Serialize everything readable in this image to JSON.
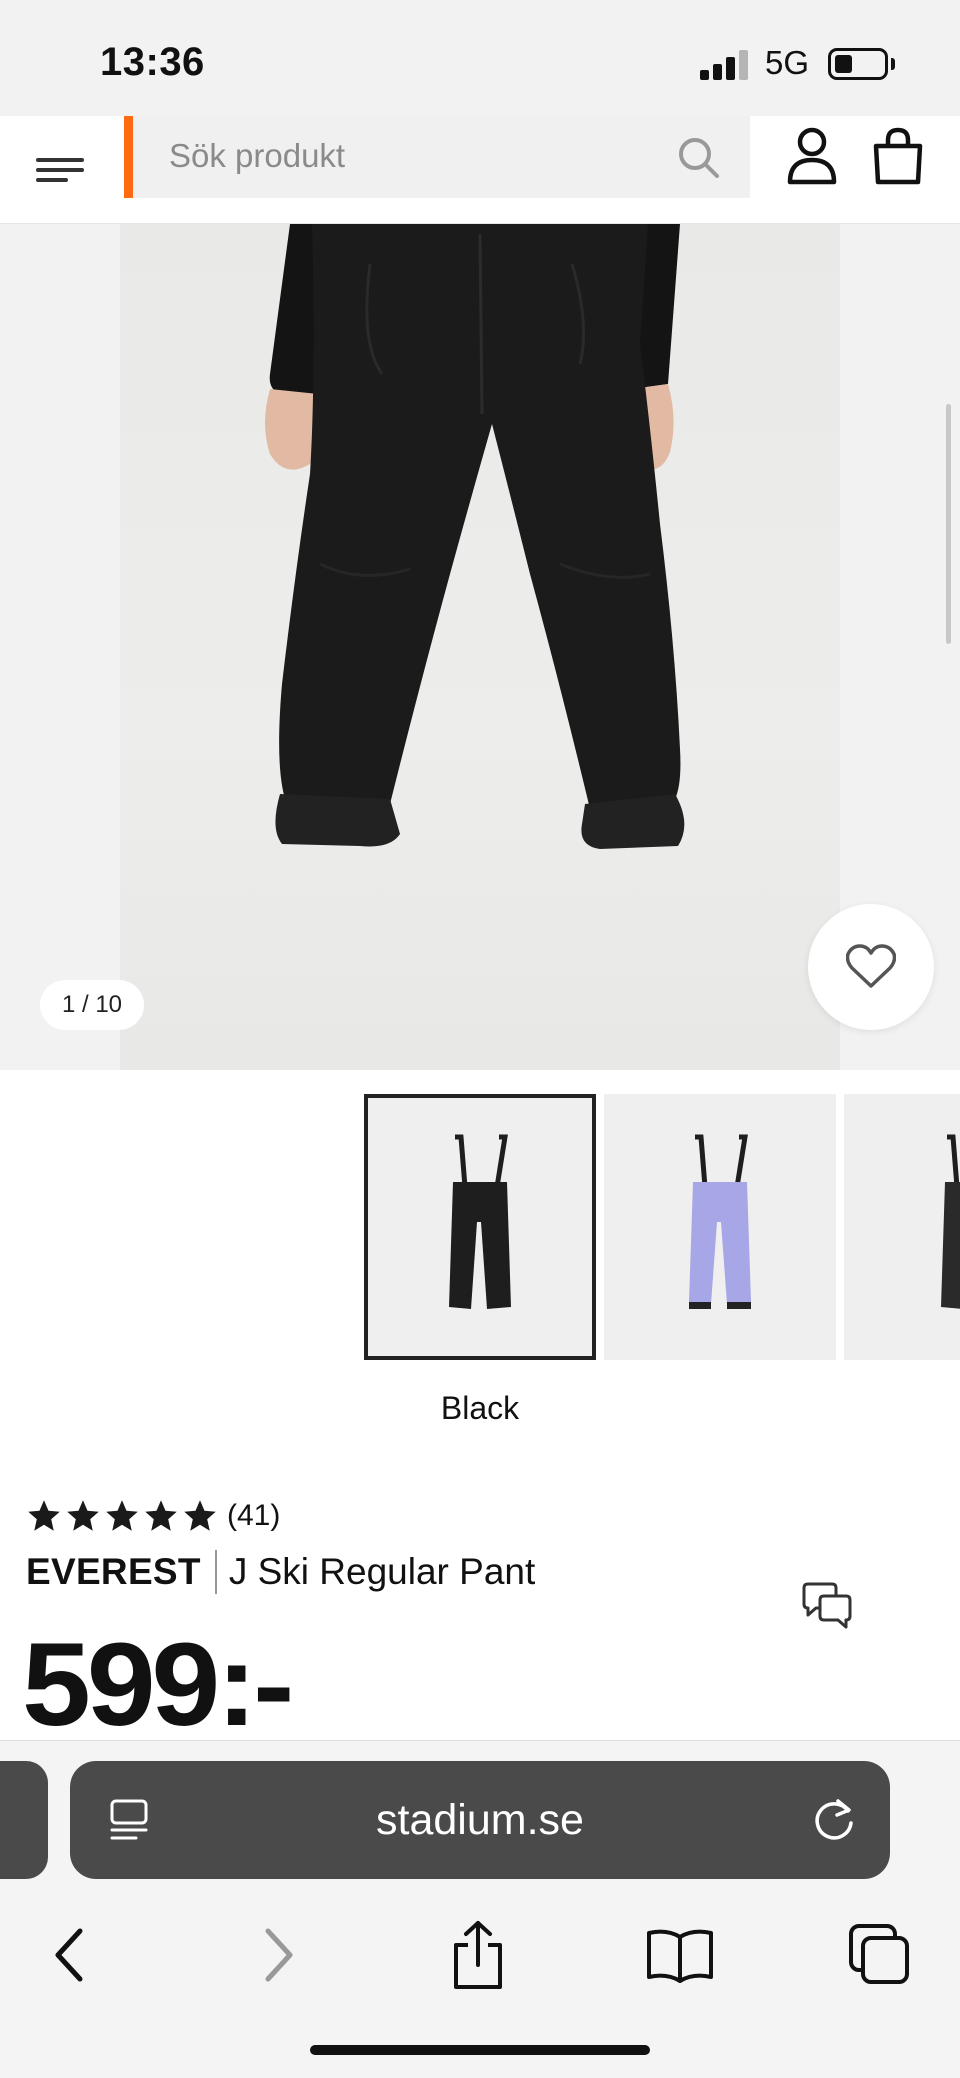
{
  "status_bar": {
    "time": "13:36",
    "network": "5G",
    "icons": [
      "signal-icon",
      "battery-icon"
    ]
  },
  "header": {
    "search_placeholder": "Sök produkt",
    "accent_color": "#ff6a13",
    "icons": [
      "menu-icon",
      "search-icon",
      "user-icon",
      "shopping-bag-icon"
    ]
  },
  "gallery": {
    "image_counter": "1 / 10",
    "icons": [
      "heart-icon"
    ]
  },
  "variants": {
    "thumbnails": [
      {
        "color": "Black",
        "hex": "#1e1e1e",
        "selected": true
      },
      {
        "color": "Lavender",
        "hex": "#a7a6e6",
        "selected": false
      },
      {
        "color": "Dark",
        "hex": "#2a2a2a",
        "selected": false
      }
    ],
    "selected_color": "Black"
  },
  "product": {
    "rating_stars": 5,
    "review_count": "(41)",
    "brand": "EVEREST",
    "name": "J Ski Regular Pant",
    "price": "599:-",
    "icons": [
      "chat-icon"
    ]
  },
  "browser": {
    "url": "stadium.se",
    "icons": [
      "reader-mode-icon",
      "reload-icon",
      "back-icon",
      "forward-icon",
      "share-icon",
      "bookmarks-icon",
      "tabs-icon"
    ]
  }
}
